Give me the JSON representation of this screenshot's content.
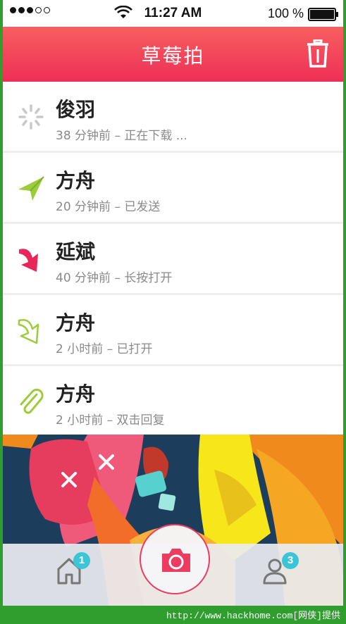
{
  "status_bar": {
    "time": "11:27 AM",
    "battery": "100 %",
    "battery_level": 1.0
  },
  "header": {
    "title": "草莓拍"
  },
  "messages": [
    {
      "name": "俊羽",
      "meta": "38 分钟前 – 正在下载 ...",
      "icon": "loading-spinner-icon"
    },
    {
      "name": "方舟",
      "meta": "20 分钟前 – 已发送",
      "icon": "paper-plane-icon"
    },
    {
      "name": "延斌",
      "meta": "40 分钟前 – 长按打开",
      "icon": "arrow-down-icon"
    },
    {
      "name": "方舟",
      "meta": "2 小时前 – 已打开",
      "icon": "arrow-down-outline-icon"
    },
    {
      "name": "方舟",
      "meta": "2 小时前 – 双击回复",
      "icon": "paperclip-icon"
    }
  ],
  "tabbar": {
    "home_badge": "1",
    "profile_badge": "3"
  },
  "watermark": "http://www.hackhome.com[网侠]提供",
  "colors": {
    "accent": "#ee2f57",
    "send": "#9ccc3c",
    "badge": "#3cc5d6"
  }
}
